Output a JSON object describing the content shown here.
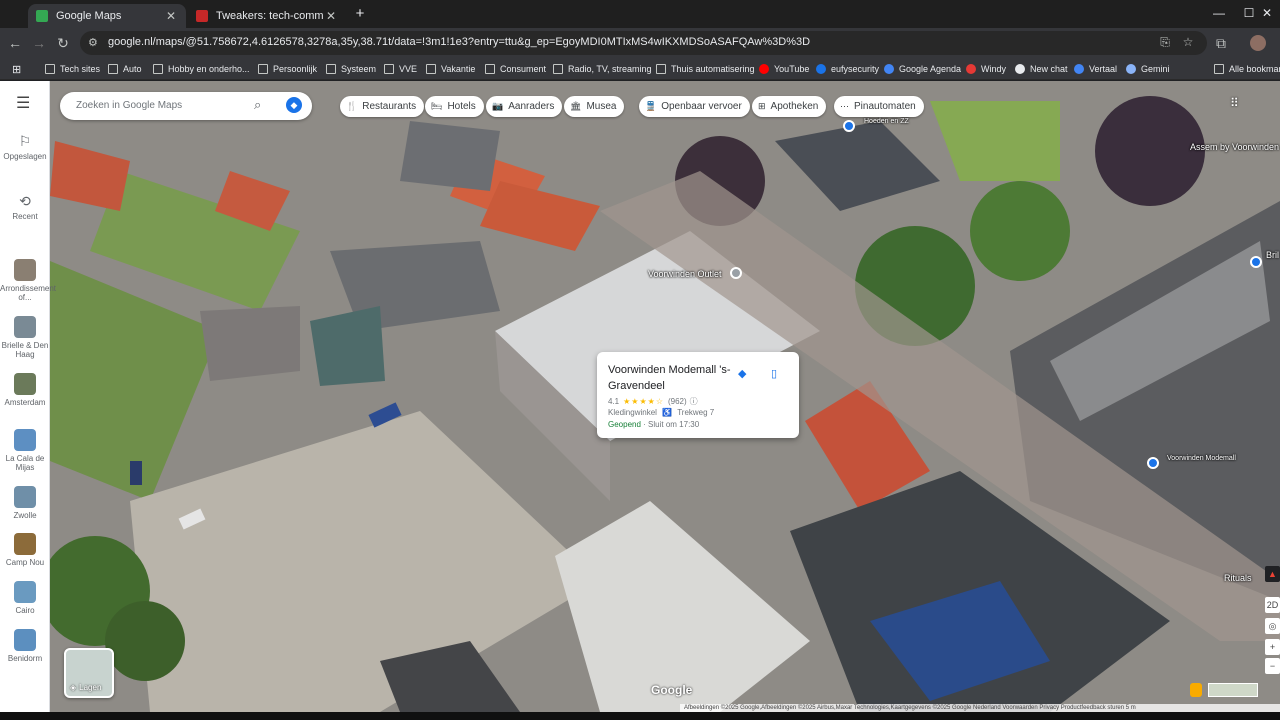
{
  "browser": {
    "tabs": [
      {
        "title": "Google Maps",
        "favicon_color": "#34a853",
        "active": true
      },
      {
        "title": "Tweakers: tech-community, nie",
        "favicon_color": "#c62828",
        "active": false
      }
    ],
    "new_tab": "+",
    "url": "google.nl/maps/@51.758672,4.6126578,3278a,35y,38.71t/data=!3m1!1e3?entry=ttu&g_ep=EgoyMDI0MTIxMS4wIKXMDSoASAFQAw%3D%3D",
    "bookmarks": [
      {
        "label": "Tech sites",
        "icon": "folder-icon"
      },
      {
        "label": "Auto",
        "icon": "folder-icon"
      },
      {
        "label": "Hobby en onderho...",
        "icon": "folder-icon"
      },
      {
        "label": "Persoonlijk",
        "icon": "folder-icon"
      },
      {
        "label": "Systeem",
        "icon": "folder-icon"
      },
      {
        "label": "VVE",
        "icon": "folder-icon"
      },
      {
        "label": "Vakantie",
        "icon": "folder-icon"
      },
      {
        "label": "Consument",
        "icon": "folder-icon"
      },
      {
        "label": "Radio, TV, streaming",
        "icon": "folder-icon"
      },
      {
        "label": "Thuis automatisering",
        "icon": "folder-icon"
      },
      {
        "label": "YouTube",
        "icon": "youtube-icon",
        "color": "#ff0000"
      },
      {
        "label": "eufysecurity",
        "icon": "eufy-icon",
        "color": "#1a73e8"
      },
      {
        "label": "Google Agenda",
        "icon": "calendar-icon",
        "color": "#4285f4"
      },
      {
        "label": "Windy",
        "icon": "windy-icon",
        "color": "#e53935"
      },
      {
        "label": "New chat",
        "icon": "chat-icon",
        "color": "#e8eaed"
      },
      {
        "label": "Vertaal",
        "icon": "translate-icon",
        "color": "#4285f4"
      },
      {
        "label": "Gemini",
        "icon": "gemini-icon",
        "color": "#8ab4f8"
      },
      {
        "label": "Alle bookmarks",
        "icon": "folder-icon"
      }
    ]
  },
  "maps": {
    "search_placeholder": "Zoeken in Google Maps",
    "chips": [
      {
        "label": "Restaurants",
        "icon": "fork-knife-icon"
      },
      {
        "label": "Hotels",
        "icon": "bed-icon"
      },
      {
        "label": "Aanraders",
        "icon": "camera-icon"
      },
      {
        "label": "Musea",
        "icon": "museum-icon"
      },
      {
        "label": "Openbaar vervoer",
        "icon": "train-icon"
      },
      {
        "label": "Apotheken",
        "icon": "pharmacy-icon"
      },
      {
        "label": "Pinautomaten",
        "icon": "atm-icon"
      }
    ],
    "rail": {
      "saved": "Opgeslagen",
      "recent": "Recent",
      "recent_places": [
        {
          "label": "Arrondissement of...",
          "thumb": "#8a7f72"
        },
        {
          "label": "Brielle & Den Haag",
          "thumb": "#7a8a95"
        },
        {
          "label": "Amsterdam",
          "thumb": "#6b7a5a"
        },
        {
          "label": "La Cala de Mijas",
          "thumb": "#5d8fc2"
        },
        {
          "label": "Zwolle",
          "thumb": "#6f8fa8"
        },
        {
          "label": "Camp Nou",
          "thumb": "#8c6b3a"
        },
        {
          "label": "Cairo",
          "thumb": "#6a9ac0"
        },
        {
          "label": "Benidorm",
          "thumb": "#5c8fbf"
        }
      ]
    },
    "place_card": {
      "name": "Voorwinden Modemall 's-Gravendeel",
      "rating": "4.1",
      "stars": "★★★★☆",
      "review_count": "(962)",
      "category": "Kledingwinkel",
      "address": "Trekweg 7",
      "open_status": "Geopend",
      "closes": "· Sluit om 17:30"
    },
    "map_labels": {
      "outlet": "Voorwinden Outlet",
      "hoeden": "Hoeden en ZZ",
      "assem": "Assem by Voorwinden",
      "bril": "Bril",
      "rituals": "Rituals",
      "voorwinden_right": "Voorwinden Modemall"
    },
    "layers_label": "Lagen",
    "google_logo": "Google",
    "attribution": "Afbeeldingen ©2025 Google,Afbeeldingen ©2025 Airbus,Maxar Technologies,Kaartgegevens ©2025 Google   Nederland   Voorwaarden   Privacy   Productfeedback sturen   5 m",
    "controls": {
      "view_2d": "2D",
      "zoom_in": "+",
      "zoom_out": "−"
    }
  }
}
